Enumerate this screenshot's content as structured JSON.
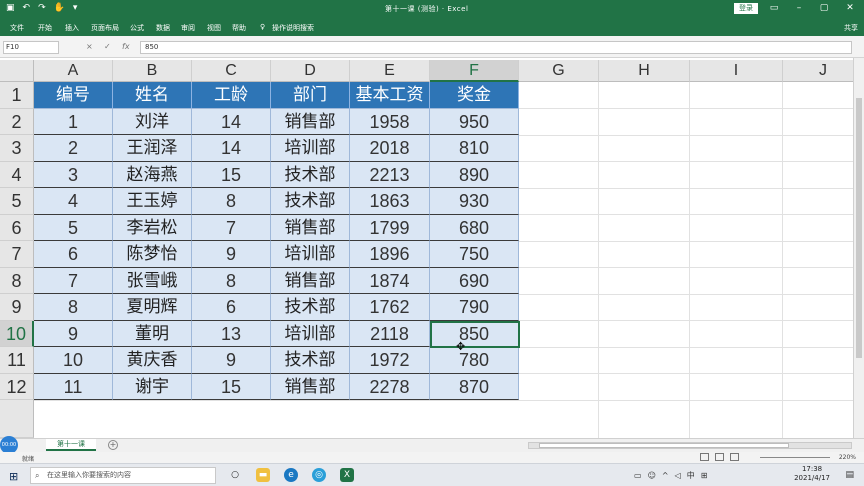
{
  "titlebar": {
    "window_title": "第十一课 (测验) · Excel",
    "login_label": "登录",
    "qat_icons": [
      "save-icon",
      "undo-icon",
      "redo-icon",
      "touch-icon",
      "customize-icon"
    ],
    "window_buttons": [
      "ribbon-display-icon",
      "minimize-icon",
      "maximize-icon",
      "close-icon"
    ],
    "accent": "#217346"
  },
  "tabs": {
    "items": [
      "文件",
      "开始",
      "插入",
      "页面布局",
      "公式",
      "数据",
      "审阅",
      "视图",
      "帮助",
      "操作说明搜索"
    ],
    "share_label": "共享"
  },
  "formula_bar": {
    "name_box": "F10",
    "formula": "850",
    "cancel_icon": "×",
    "enter_icon": "✓",
    "fx_label": "fx"
  },
  "columns": [
    "A",
    "B",
    "C",
    "D",
    "E",
    "F",
    "G",
    "H",
    "I",
    "J"
  ],
  "rows": [
    "1",
    "2",
    "3",
    "4",
    "5",
    "6",
    "7",
    "8",
    "9",
    "10",
    "11",
    "12"
  ],
  "table": {
    "headers": [
      "编号",
      "姓名",
      "工龄",
      "部门",
      "基本工资",
      "奖金"
    ],
    "rows": [
      [
        "1",
        "刘洋",
        "14",
        "销售部",
        "1958",
        "950"
      ],
      [
        "2",
        "王润泽",
        "14",
        "培训部",
        "2018",
        "810"
      ],
      [
        "3",
        "赵海燕",
        "15",
        "技术部",
        "2213",
        "890"
      ],
      [
        "4",
        "王玉婷",
        "8",
        "技术部",
        "1863",
        "930"
      ],
      [
        "5",
        "李岩松",
        "7",
        "销售部",
        "1799",
        "680"
      ],
      [
        "6",
        "陈梦怡",
        "9",
        "培训部",
        "1896",
        "750"
      ],
      [
        "7",
        "张雪峨",
        "8",
        "销售部",
        "1874",
        "690"
      ],
      [
        "8",
        "夏明辉",
        "6",
        "技术部",
        "1762",
        "790"
      ],
      [
        "9",
        "董明",
        "13",
        "培训部",
        "2118",
        "850"
      ],
      [
        "10",
        "黄庆香",
        "9",
        "技术部",
        "1972",
        "780"
      ],
      [
        "11",
        "谢宇",
        "15",
        "销售部",
        "2278",
        "870"
      ]
    ],
    "header_color": "#2e75b6",
    "body_color": "#dae6f4"
  },
  "sheet_tab": "第十一课",
  "status": {
    "ready": "就绪",
    "zoom": "220%",
    "rec_badge": "00:00"
  },
  "taskbar": {
    "search_placeholder": "在这里输入你要搜索的内容",
    "time": "17:38",
    "date": "2021/4/17",
    "tray_lang": "中"
  }
}
